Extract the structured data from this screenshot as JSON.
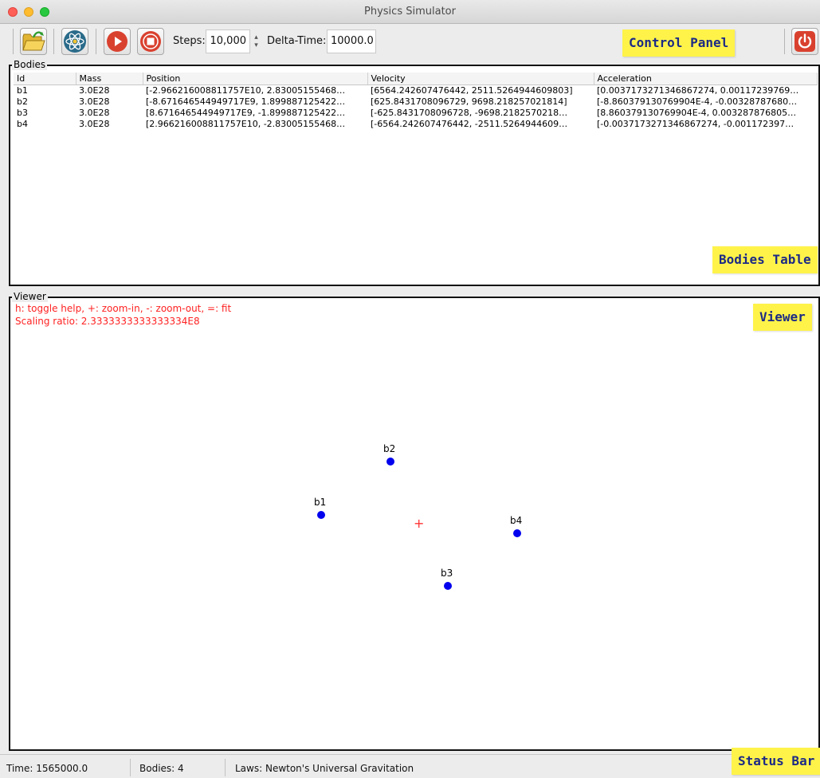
{
  "window": {
    "title": "Physics Simulator"
  },
  "toolbar": {
    "steps_label": "Steps:",
    "steps_value": "10,000",
    "delta_label": "Delta-Time:",
    "delta_value": "10000.0"
  },
  "bodies_panel": {
    "legend": "Bodies",
    "columns": [
      "Id",
      "Mass",
      "Position",
      "Velocity",
      "Acceleration"
    ],
    "rows": [
      [
        "b1",
        "3.0E28",
        "[-2.966216008811757E10, 2.83005155468…",
        "[6564.242607476442, 2511.5264944609803]",
        "[0.0037173271346867274, 0.00117239769…"
      ],
      [
        "b2",
        "3.0E28",
        "[-8.671646544949717E9, 1.899887125422…",
        "[625.8431708096729, 9698.218257021814]",
        "[-8.860379130769904E-4, -0.00328787680…"
      ],
      [
        "b3",
        "3.0E28",
        "[8.671646544949717E9, -1.899887125422…",
        "[-625.8431708096728, -9698.2182570218…",
        "[8.860379130769904E-4, 0.003287876805…"
      ],
      [
        "b4",
        "3.0E28",
        "[2.966216008811757E10, -2.83005155468…",
        "[-6564.242607476442, -2511.5264944609…",
        "[-0.0037173271346867274, -0.001172397…"
      ]
    ]
  },
  "viewer": {
    "legend": "Viewer",
    "help_text": "h: toggle help, +: zoom-in, -: zoom-out, =: fit",
    "scaling_text": "Scaling ratio:  2.3333333333333334E8",
    "bodies": [
      {
        "id": "b1"
      },
      {
        "id": "b2"
      },
      {
        "id": "b3"
      },
      {
        "id": "b4"
      }
    ]
  },
  "status": {
    "time": "Time:  1565000.0",
    "bodies": "Bodies:  4",
    "laws": "Laws:  Newton's Universal Gravitation"
  },
  "annotations": {
    "control_panel": "Control Panel",
    "bodies_table": "Bodies Table",
    "viewer": "Viewer",
    "status_bar": "Status Bar"
  },
  "colors": {
    "body": "#0000ee",
    "help_text": "#ff2222",
    "note": "#fff34a"
  },
  "icons": [
    "folder-open-icon",
    "atom-icon",
    "play-icon",
    "stop-icon",
    "power-icon",
    "spinner-arrows-icon",
    "center-cross-icon"
  ]
}
